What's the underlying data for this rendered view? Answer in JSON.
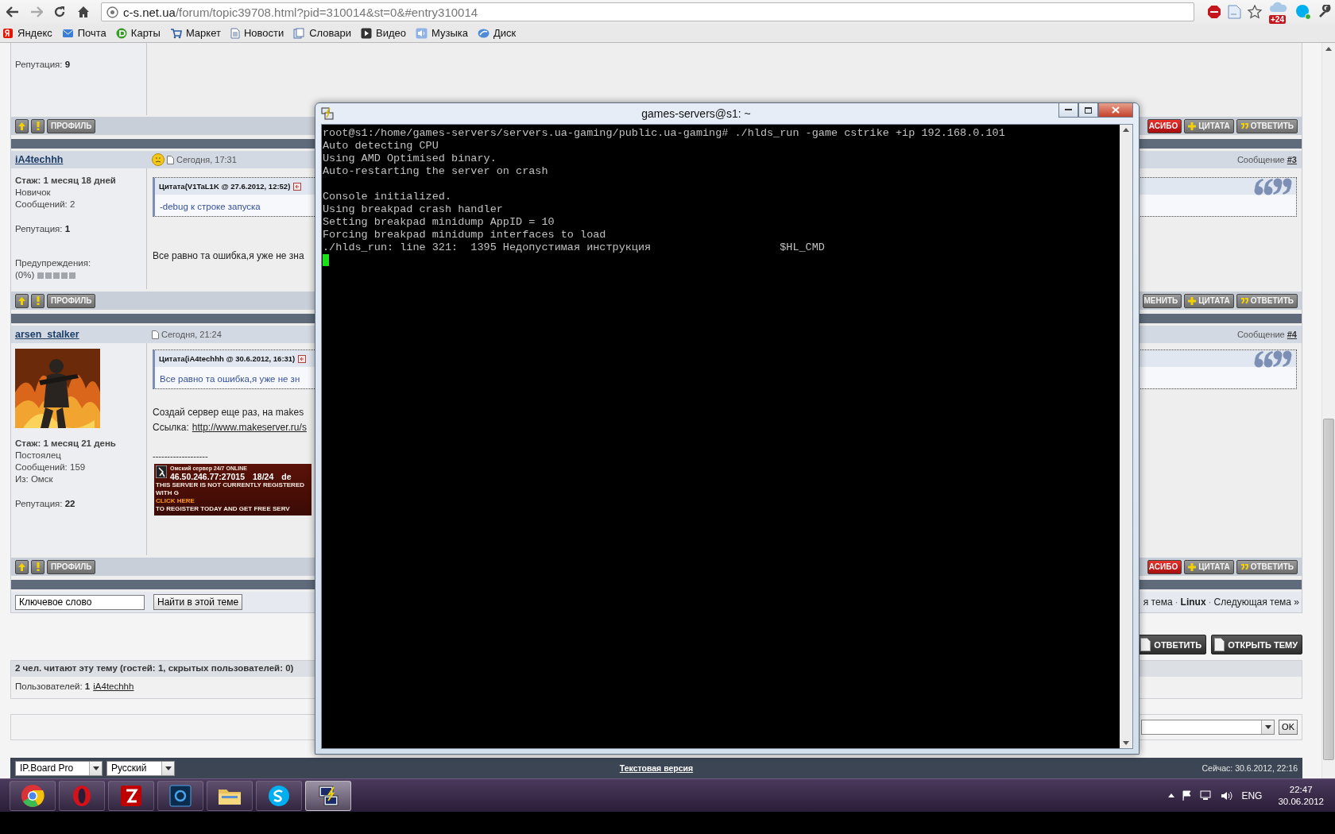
{
  "browser": {
    "url_host": "c-s.net.ua",
    "url_path": "/forum/topic39708.html?pid=310014&st=0&#entry310014",
    "weather_badge": "+24"
  },
  "bookmarks": [
    {
      "label": "Яндекс"
    },
    {
      "label": "Почта"
    },
    {
      "label": "Карты"
    },
    {
      "label": "Маркет"
    },
    {
      "label": "Новости"
    },
    {
      "label": "Словари"
    },
    {
      "label": "Видео"
    },
    {
      "label": "Музыка"
    },
    {
      "label": "Диск"
    }
  ],
  "posts": [
    {
      "kind": "tail",
      "user_info": [
        {
          "kind": "rating",
          "text": "Репутация: **9**"
        }
      ],
      "bar": {
        "profile": "ПРОФИЛЬ",
        "actions": [
          {
            "label": "АСИБО",
            "kind": "thanks"
          },
          {
            "label": "ЦИТАТА",
            "kind": "quote"
          },
          {
            "label": "ОТВЕТИТЬ",
            "kind": "reply"
          }
        ]
      }
    },
    {
      "kind": "full",
      "author": "iA4techhh",
      "has_mood": true,
      "date": "Сегодня, 17:31",
      "number_label": "Сообщение",
      "number": "#3",
      "avatar": false,
      "user_info": [
        {
          "kind": "tenure",
          "text": "Стаж: 1 месяц 18 дней"
        },
        {
          "kind": "line",
          "text": "Новичок"
        },
        {
          "kind": "line",
          "text": "Сообщений: 2"
        },
        {
          "kind": "rating",
          "text": "Репутация: **1**"
        }
      ],
      "warnings": {
        "label": "Предупреждения:",
        "value": "(0%)",
        "level": 0
      },
      "quote": {
        "header": "Цитата(V1TaL1K @ 27.6.2012, 12:52)",
        "text": "-debug к строке запуска"
      },
      "body": [
        {
          "kind": "text",
          "text": "Все равно та ошибка,я уже не зна"
        }
      ],
      "bar": {
        "profile": "ПРОФИЛЬ",
        "actions": [
          {
            "label": "МЕНИТЬ",
            "kind": "edit"
          },
          {
            "label": "ЦИТАТА",
            "kind": "quote"
          },
          {
            "label": "ОТВЕТИТЬ",
            "kind": "reply"
          }
        ]
      }
    },
    {
      "kind": "full",
      "author": "arsen_stalker",
      "has_mood": false,
      "date": "Сегодня, 21:24",
      "number_label": "Сообщение",
      "number": "#4",
      "avatar": true,
      "user_info": [
        {
          "kind": "tenure",
          "text": "Стаж: 1 месяц 21 день"
        },
        {
          "kind": "line",
          "text": "Постоялец"
        },
        {
          "kind": "line",
          "text": "Сообщений: 159"
        },
        {
          "kind": "line",
          "text": "Из: Омск"
        },
        {
          "kind": "rating",
          "text": "Репутация: **22**"
        }
      ],
      "quote": {
        "header": "Цитата(iA4techhh @ 30.6.2012, 16:31)",
        "text": "Все равно та ошибка,я уже не зн"
      },
      "body": [
        {
          "kind": "text",
          "text": "Создай сервер еще раз, на makes"
        },
        {
          "kind": "link_line",
          "label": "Ссылка:",
          "link": "http://www.makeserver.ru/s"
        },
        {
          "kind": "rule",
          "text": "-------------------"
        },
        {
          "kind": "banner",
          "title": "Омский сервер 24/7 ONLINE",
          "address": "46.50.246.77:27015",
          "players": "18/24",
          "map": "de",
          "notice": "THIS SERVER IS NOT CURRENTLY REGISTERED WITH G",
          "cta": "CLICK HERE",
          "cta_rest": "TO REGISTER TODAY AND GET FREE SERV"
        }
      ],
      "bar": {
        "profile": "ПРОФИЛЬ",
        "actions": [
          {
            "label": "АСИБО",
            "kind": "thanks"
          },
          {
            "label": "ЦИТАТА",
            "kind": "quote"
          },
          {
            "label": "ОТВЕТИТЬ",
            "kind": "reply"
          }
        ]
      }
    }
  ],
  "search": {
    "value": "Ключевое слово",
    "button": "Найти в этой теме",
    "nav_prev": "я тема",
    "separator": "·",
    "nav_current": "Linux",
    "nav_next": "Следующая тема »"
  },
  "topic_buttons": [
    "ОТВЕТИТЬ",
    "ОТКРЫТЬ ТЕМУ"
  ],
  "active_users": {
    "title": "2 чел. читают эту тему (гостей: 1, скрытых пользователей: 0)",
    "label": "Пользователей: **1**",
    "user": "iA4techhh"
  },
  "jump": {
    "ok": "OK"
  },
  "footer": {
    "skin": "IP.Board Pro",
    "language": "Русский",
    "text_version": "Текстовая версия",
    "now": "Сейчас: 30.6.2012, 22:16"
  },
  "terminal": {
    "title": "games-servers@s1: ~",
    "lines": [
      {
        "kind": "text",
        "text": "root@s1:/home/games-servers/servers.ua-gaming/public.ua-gaming# ./hlds_run -game cstrike +ip 192.168.0.101"
      },
      {
        "kind": "text",
        "text": "Auto detecting CPU"
      },
      {
        "kind": "text",
        "text": "Using AMD Optimised binary."
      },
      {
        "kind": "text",
        "text": "Auto-restarting the server on crash"
      },
      {
        "kind": "blank"
      },
      {
        "kind": "text",
        "text": "Console initialized."
      },
      {
        "kind": "text",
        "text": "Using breakpad crash handler"
      },
      {
        "kind": "text",
        "text": "Setting breakpad minidump AppID = 10"
      },
      {
        "kind": "text",
        "text": "Forcing breakpad minidump interfaces to load"
      },
      {
        "kind": "text",
        "text": "./hlds_run: line 321:  1395 Недопустимая инструкция                    $HL_CMD"
      },
      {
        "kind": "cursor"
      }
    ]
  },
  "taskbar": {
    "apps": [
      {
        "selected": false
      },
      {
        "selected": false
      },
      {
        "selected": false
      },
      {
        "selected": false
      },
      {
        "selected": false
      },
      {
        "selected": false
      },
      {
        "selected": true
      }
    ],
    "lang": "ENG",
    "time": "22:47",
    "date": "30.06.2012"
  }
}
